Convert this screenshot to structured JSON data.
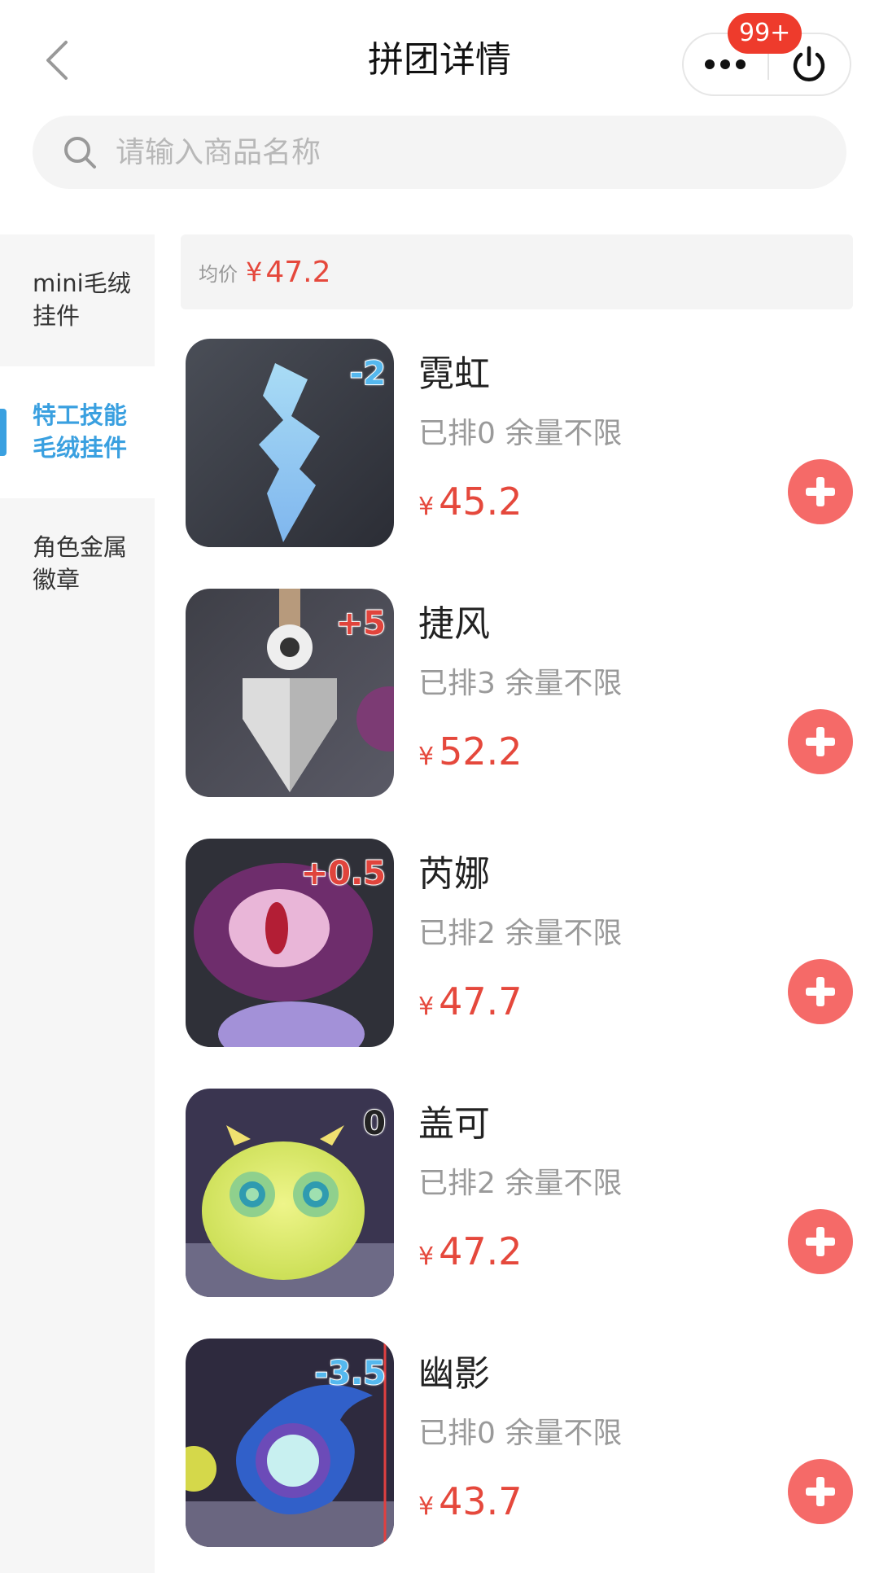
{
  "header": {
    "title": "拼团详情",
    "badge": "99+"
  },
  "search": {
    "placeholder": "请输入商品名称"
  },
  "sidebar": {
    "items": [
      {
        "label_line1": "mini毛绒",
        "label_line2": "挂件",
        "active": false
      },
      {
        "label_line1": "特工技能",
        "label_line2": "毛绒挂件",
        "active": true
      },
      {
        "label_line1": "角色金属",
        "label_line2": "徽章",
        "active": false
      }
    ]
  },
  "average": {
    "label": "均价",
    "currency": "¥",
    "value": "47.2"
  },
  "products": [
    {
      "name": "霓虹",
      "meta": "已排0 余量不限",
      "currency": "¥",
      "price": "45.2",
      "delta": "-2",
      "delta_kind": "neg"
    },
    {
      "name": "捷风",
      "meta": "已排3 余量不限",
      "currency": "¥",
      "price": "52.2",
      "delta": "+5",
      "delta_kind": "pos"
    },
    {
      "name": "芮娜",
      "meta": "已排2 余量不限",
      "currency": "¥",
      "price": "47.7",
      "delta": "+0.5",
      "delta_kind": "pos"
    },
    {
      "name": "盖可",
      "meta": "已排2 余量不限",
      "currency": "¥",
      "price": "47.2",
      "delta": "0",
      "delta_kind": "zero"
    },
    {
      "name": "幽影",
      "meta": "已排0 余量不限",
      "currency": "¥",
      "price": "43.7",
      "delta": "-3.5",
      "delta_kind": "neg"
    }
  ],
  "colors": {
    "accent": "#3aa0e0",
    "price": "#e5483c",
    "add_button": "#f56a68",
    "badge": "#ee3b2c"
  }
}
